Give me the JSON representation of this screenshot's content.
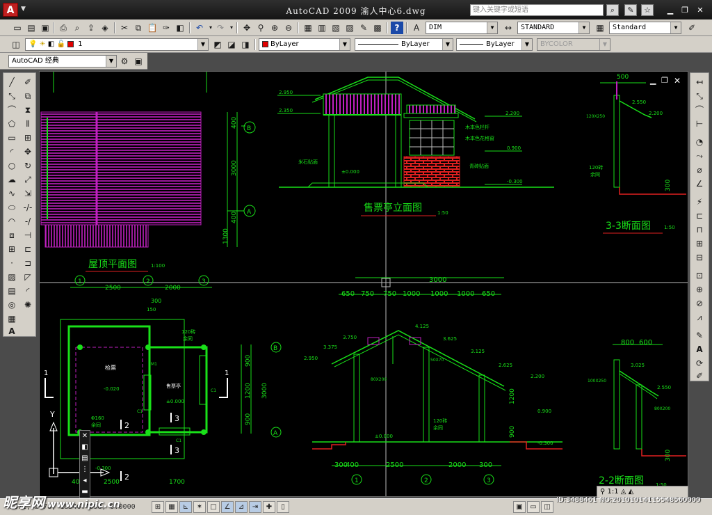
{
  "titlebar": {
    "app_icon": "A",
    "title": "AutoCAD 2009  渝人中心6.dwg",
    "search_placeholder": "键入关键字或短语"
  },
  "toolbar1": {
    "text_style": "DIM",
    "dim_style": "STANDARD",
    "table_style": "Standard"
  },
  "toolbar2": {
    "layer": "1",
    "color": "ByLayer",
    "linetype": "ByLayer",
    "lineweight": "ByLayer",
    "plot_style": "BYCOLOR"
  },
  "toolbar3": {
    "workspace": "AutoCAD 经典"
  },
  "drawing": {
    "labels": {
      "roof_plan": "屋顶平面图",
      "roof_plan_scale": "1:100",
      "elevation": "售票亭立面图",
      "elevation_scale": "1:50",
      "section33": "3-3断面图",
      "section33_scale": "1:50",
      "section22": "2-2断面图",
      "section22_scale": "1:50",
      "room1": "检票",
      "room2": "售票亭",
      "axis_a": "A",
      "axis_b": "B",
      "axis_1": "1",
      "axis_2": "2",
      "axis_3": "3",
      "ucs_y": "Y",
      "sec1": "1",
      "sec2": "2",
      "sec3": "3",
      "m1": "M1",
      "c1": "C1",
      "dims": {
        "d2500": "2500",
        "d2000": "2000",
        "d3000": "3000",
        "d400": "400",
        "d1300": "1300",
        "d900": "900",
        "d1200": "1200",
        "d300": "300",
        "d650": "650",
        "d750": "750",
        "d1000": "1000",
        "d500": "500",
        "d800": "800",
        "d600": "600",
        "d1700": "1700",
        "d150": "150",
        "d300b": "300",
        "d400b": "400"
      },
      "elev": {
        "e2950": "2.950",
        "e2350": "2.350",
        "e2200": "2.200",
        "e0900": "0.900",
        "e0000": "±0.000",
        "e0300": "-0.300",
        "e3750": "3.750",
        "e3375": "3.375",
        "e4125": "4.125",
        "e3625": "3.625",
        "e3125": "3.125",
        "e2625": "2.625",
        "e2550": "2.550",
        "e3025": "3.025",
        "e0020": "-0.020",
        "e0000b": "±0.000"
      },
      "notes": {
        "n1": "木本色栏杆",
        "n2": "木本色花格窗",
        "n3": "青砖贴面",
        "n4": "米石贴面",
        "n5": "120砖",
        "n6": "余同",
        "n7": "80X200",
        "n8": "50X70",
        "n9": "120X250",
        "n10": "100X250",
        "n11": "Φ160"
      }
    }
  },
  "statusbar": {
    "coords": "2871, 2878, 18346.4098, 0.0000",
    "scale": "1:1"
  },
  "watermark": {
    "brand": "昵享网",
    "url": "www.nipic.cn",
    "id": "ID:3488461 NO:20101014115548560000"
  }
}
